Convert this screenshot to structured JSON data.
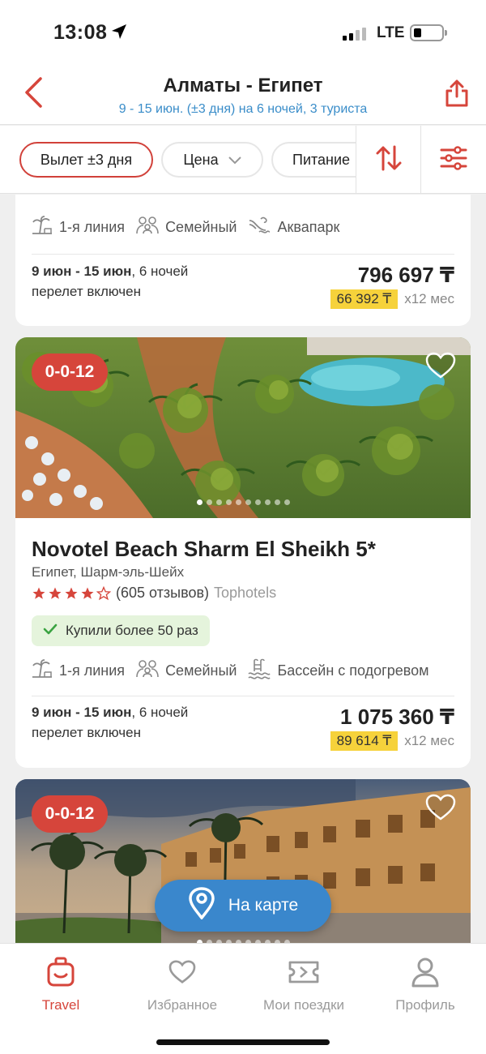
{
  "status": {
    "time": "13:08",
    "network": "LTE"
  },
  "header": {
    "title": "Алматы - Египет",
    "subtitle": "9 - 15 июн. (±3 дня) на 6 ночей, 3 туриста"
  },
  "filters": {
    "chips": [
      "Вылет ±3 дня",
      "Цена",
      "Питание"
    ]
  },
  "cards": [
    {
      "features": [
        "1-я линия",
        "Семейный",
        "Аквапарк"
      ],
      "dates_bold": "9 июн - 15 июн",
      "nights": ", 6 ночей",
      "flight": "перелет включен",
      "price": "796 697 ₸",
      "monthly": "66 392 ₸",
      "months": "x12 мес"
    },
    {
      "sale": "0-0-12",
      "name": "Novotel Beach Sharm El Sheikh 5*",
      "location": "Египет, Шарм-эль-Шейх",
      "stars": 4,
      "reviews": "(605 отзывов)",
      "review_source": "Tophotels",
      "badge": "Купили более 50 раз",
      "features": [
        "1-я линия",
        "Семейный",
        "Бассейн с подогревом"
      ],
      "dates_bold": "9 июн - 15 июн",
      "nights": ", 6 ночей",
      "flight": "перелет включен",
      "price": "1 075 360 ₸",
      "monthly": "89 614 ₸",
      "months": "x12 мес"
    },
    {
      "sale": "0-0-12"
    }
  ],
  "map_button": "На карте",
  "tabs": [
    "Travel",
    "Избранное",
    "Мои поездки",
    "Профиль"
  ],
  "colors": {
    "accent": "#d6453b",
    "link": "#3a8dc9",
    "price_highlight": "#f6d23b",
    "map_button": "#3a87cc"
  }
}
